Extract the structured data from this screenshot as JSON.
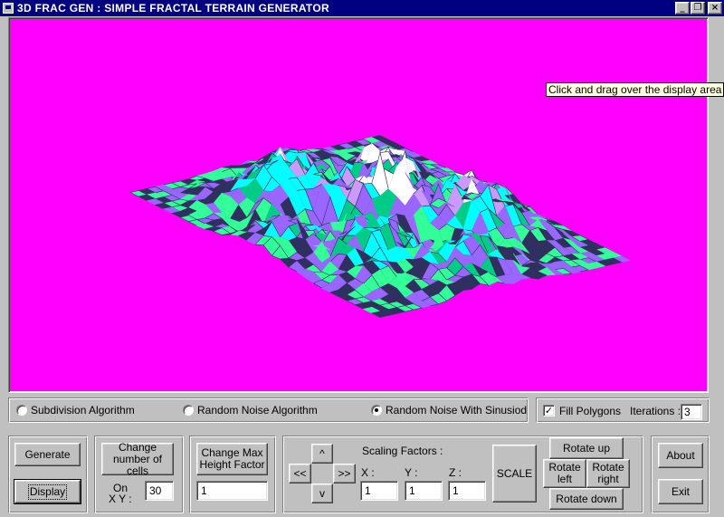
{
  "window": {
    "title": "3D FRAC GEN : SIMPLE FRACTAL TERRAIN GENERATOR",
    "minimize_glyph": "_",
    "restore_glyph": "❐",
    "close_glyph": "×"
  },
  "display": {
    "background": "#ff00ff",
    "tooltip": "Click and drag over the display area",
    "terrain_colors": [
      "#00ffff",
      "#9966ff",
      "#00cc88",
      "#ffffff",
      "#303060",
      "#cc99ff",
      "#33ff99"
    ]
  },
  "algorithms": {
    "options": [
      {
        "label": "Subdivision Algorithm",
        "selected": false
      },
      {
        "label": "Random Noise Algorithm",
        "selected": false
      },
      {
        "label": "Random Noise With Sinusiod",
        "selected": true
      }
    ]
  },
  "options": {
    "fill_polygons_label": "Fill Polygons",
    "fill_polygons_checked": true,
    "iterations_label": "Iterations :",
    "iterations_value": "3"
  },
  "actions": {
    "generate_label": "Generate",
    "display_label": "Display"
  },
  "cells": {
    "button_label_line1": "Change",
    "button_label_line2": "number of cells",
    "on_label": "On",
    "xy_label": "X Y :",
    "value": "30"
  },
  "height": {
    "button_label_line1": "Change Max",
    "button_label_line2": "Height Factor",
    "value": "1"
  },
  "navigation": {
    "up": "^",
    "down": "v",
    "left": "<<",
    "right": ">>"
  },
  "scaling": {
    "title": "Scaling Factors :",
    "x_label": "X :",
    "y_label": "Y :",
    "z_label": "Z :",
    "x_value": "1",
    "y_value": "1",
    "z_value": "1",
    "scale_label": "SCALE"
  },
  "rotation": {
    "up_label": "Rotate up",
    "left_line1": "Rotate",
    "left_line2": "left",
    "right_line1": "Rotate",
    "right_line2": "right",
    "down_label": "Rotate down"
  },
  "misc": {
    "about_label": "About",
    "exit_label": "Exit"
  }
}
